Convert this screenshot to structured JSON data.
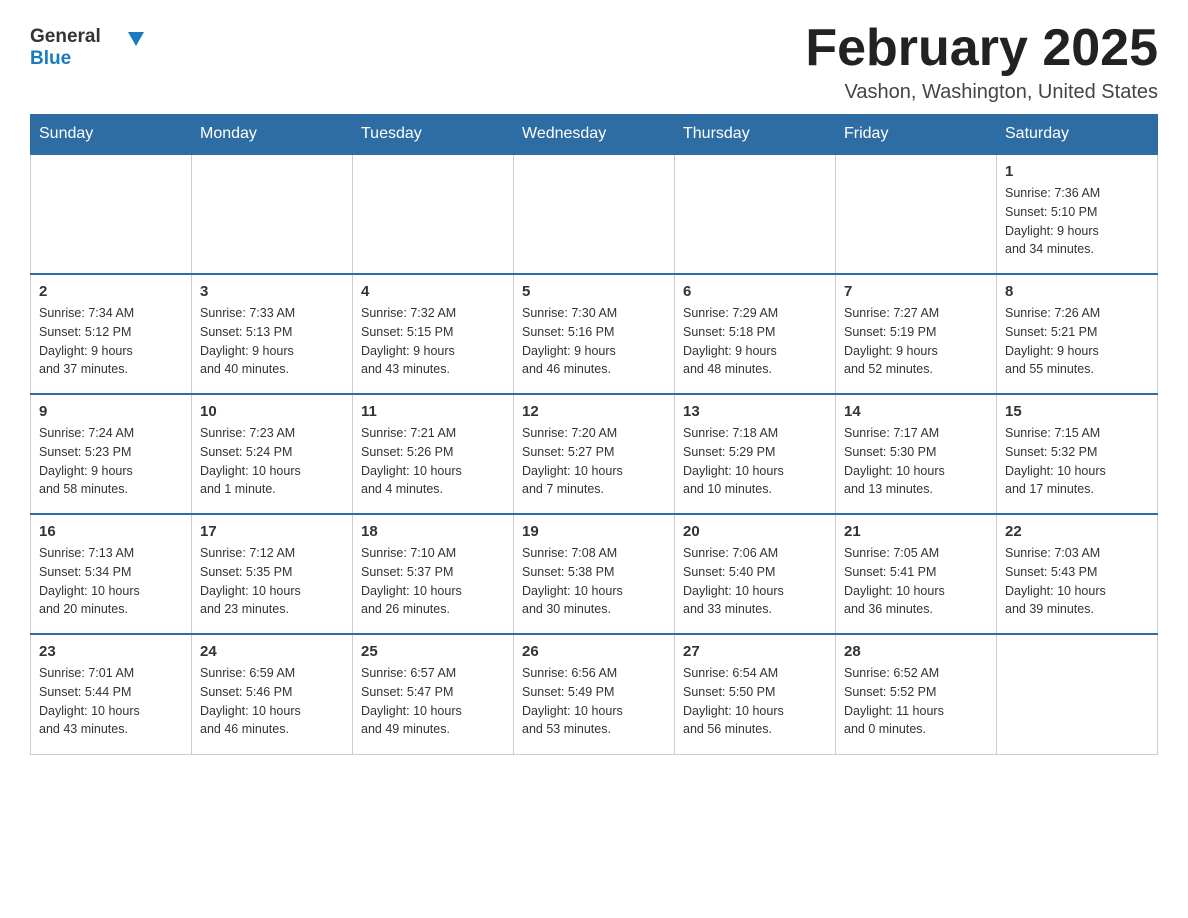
{
  "header": {
    "logo_text_general": "General",
    "logo_text_blue": "Blue",
    "month_title": "February 2025",
    "location": "Vashon, Washington, United States"
  },
  "days_of_week": [
    "Sunday",
    "Monday",
    "Tuesday",
    "Wednesday",
    "Thursday",
    "Friday",
    "Saturday"
  ],
  "weeks": [
    [
      {
        "day": "",
        "info": ""
      },
      {
        "day": "",
        "info": ""
      },
      {
        "day": "",
        "info": ""
      },
      {
        "day": "",
        "info": ""
      },
      {
        "day": "",
        "info": ""
      },
      {
        "day": "",
        "info": ""
      },
      {
        "day": "1",
        "info": "Sunrise: 7:36 AM\nSunset: 5:10 PM\nDaylight: 9 hours\nand 34 minutes."
      }
    ],
    [
      {
        "day": "2",
        "info": "Sunrise: 7:34 AM\nSunset: 5:12 PM\nDaylight: 9 hours\nand 37 minutes."
      },
      {
        "day": "3",
        "info": "Sunrise: 7:33 AM\nSunset: 5:13 PM\nDaylight: 9 hours\nand 40 minutes."
      },
      {
        "day": "4",
        "info": "Sunrise: 7:32 AM\nSunset: 5:15 PM\nDaylight: 9 hours\nand 43 minutes."
      },
      {
        "day": "5",
        "info": "Sunrise: 7:30 AM\nSunset: 5:16 PM\nDaylight: 9 hours\nand 46 minutes."
      },
      {
        "day": "6",
        "info": "Sunrise: 7:29 AM\nSunset: 5:18 PM\nDaylight: 9 hours\nand 48 minutes."
      },
      {
        "day": "7",
        "info": "Sunrise: 7:27 AM\nSunset: 5:19 PM\nDaylight: 9 hours\nand 52 minutes."
      },
      {
        "day": "8",
        "info": "Sunrise: 7:26 AM\nSunset: 5:21 PM\nDaylight: 9 hours\nand 55 minutes."
      }
    ],
    [
      {
        "day": "9",
        "info": "Sunrise: 7:24 AM\nSunset: 5:23 PM\nDaylight: 9 hours\nand 58 minutes."
      },
      {
        "day": "10",
        "info": "Sunrise: 7:23 AM\nSunset: 5:24 PM\nDaylight: 10 hours\nand 1 minute."
      },
      {
        "day": "11",
        "info": "Sunrise: 7:21 AM\nSunset: 5:26 PM\nDaylight: 10 hours\nand 4 minutes."
      },
      {
        "day": "12",
        "info": "Sunrise: 7:20 AM\nSunset: 5:27 PM\nDaylight: 10 hours\nand 7 minutes."
      },
      {
        "day": "13",
        "info": "Sunrise: 7:18 AM\nSunset: 5:29 PM\nDaylight: 10 hours\nand 10 minutes."
      },
      {
        "day": "14",
        "info": "Sunrise: 7:17 AM\nSunset: 5:30 PM\nDaylight: 10 hours\nand 13 minutes."
      },
      {
        "day": "15",
        "info": "Sunrise: 7:15 AM\nSunset: 5:32 PM\nDaylight: 10 hours\nand 17 minutes."
      }
    ],
    [
      {
        "day": "16",
        "info": "Sunrise: 7:13 AM\nSunset: 5:34 PM\nDaylight: 10 hours\nand 20 minutes."
      },
      {
        "day": "17",
        "info": "Sunrise: 7:12 AM\nSunset: 5:35 PM\nDaylight: 10 hours\nand 23 minutes."
      },
      {
        "day": "18",
        "info": "Sunrise: 7:10 AM\nSunset: 5:37 PM\nDaylight: 10 hours\nand 26 minutes."
      },
      {
        "day": "19",
        "info": "Sunrise: 7:08 AM\nSunset: 5:38 PM\nDaylight: 10 hours\nand 30 minutes."
      },
      {
        "day": "20",
        "info": "Sunrise: 7:06 AM\nSunset: 5:40 PM\nDaylight: 10 hours\nand 33 minutes."
      },
      {
        "day": "21",
        "info": "Sunrise: 7:05 AM\nSunset: 5:41 PM\nDaylight: 10 hours\nand 36 minutes."
      },
      {
        "day": "22",
        "info": "Sunrise: 7:03 AM\nSunset: 5:43 PM\nDaylight: 10 hours\nand 39 minutes."
      }
    ],
    [
      {
        "day": "23",
        "info": "Sunrise: 7:01 AM\nSunset: 5:44 PM\nDaylight: 10 hours\nand 43 minutes."
      },
      {
        "day": "24",
        "info": "Sunrise: 6:59 AM\nSunset: 5:46 PM\nDaylight: 10 hours\nand 46 minutes."
      },
      {
        "day": "25",
        "info": "Sunrise: 6:57 AM\nSunset: 5:47 PM\nDaylight: 10 hours\nand 49 minutes."
      },
      {
        "day": "26",
        "info": "Sunrise: 6:56 AM\nSunset: 5:49 PM\nDaylight: 10 hours\nand 53 minutes."
      },
      {
        "day": "27",
        "info": "Sunrise: 6:54 AM\nSunset: 5:50 PM\nDaylight: 10 hours\nand 56 minutes."
      },
      {
        "day": "28",
        "info": "Sunrise: 6:52 AM\nSunset: 5:52 PM\nDaylight: 11 hours\nand 0 minutes."
      },
      {
        "day": "",
        "info": ""
      }
    ]
  ]
}
